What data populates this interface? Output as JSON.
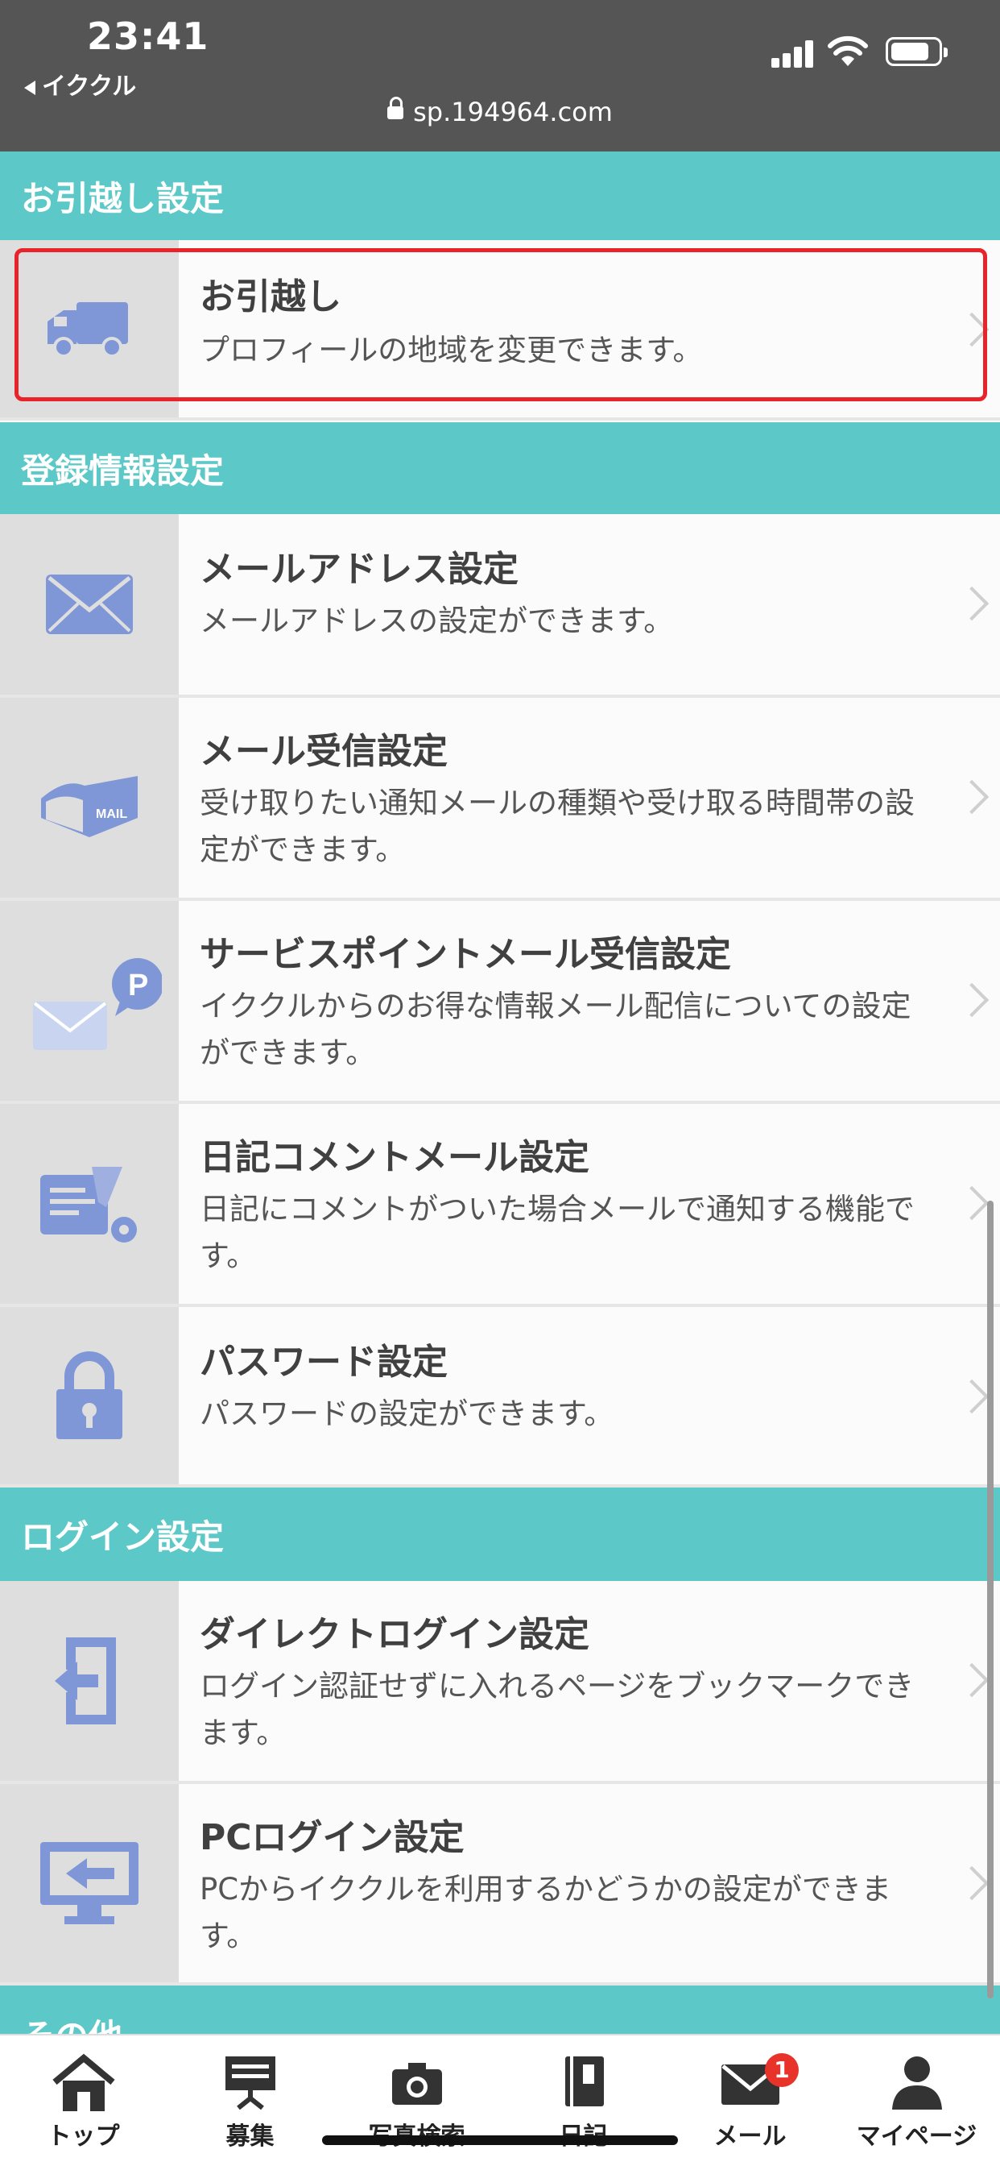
{
  "status": {
    "time": "23:41",
    "back_app": "イククル",
    "url": "sp.194964.com"
  },
  "sections": {
    "moving": {
      "header": "お引越し設定",
      "items": [
        {
          "title": "お引越し",
          "desc": "プロフィールの地域を変更できます。"
        }
      ]
    },
    "registration": {
      "header": "登録情報設定",
      "items": [
        {
          "title": "メールアドレス設定",
          "desc": "メールアドレスの設定ができます。"
        },
        {
          "title": "メール受信設定",
          "desc": "受け取りたい通知メールの種類や受け取る時間帯の設定ができます。"
        },
        {
          "title": "サービスポイントメール受信設定",
          "desc": "イククルからのお得な情報メール配信についての設定ができます。"
        },
        {
          "title": "日記コメントメール設定",
          "desc": "日記にコメントがついた場合メールで通知する機能です。"
        },
        {
          "title": "パスワード設定",
          "desc": "パスワードの設定ができます。"
        }
      ]
    },
    "login": {
      "header": "ログイン設定",
      "items": [
        {
          "title": "ダイレクトログイン設定",
          "desc": "ログイン認証せずに入れるページをブックマークできます。"
        },
        {
          "title": "PCログイン設定",
          "desc": "PCからイククルを利用するかどうかの設定ができます。"
        }
      ]
    },
    "other": {
      "header": "その他"
    }
  },
  "icons": {
    "moving": "truck-icon",
    "email": "envelope-icon",
    "mail_receive": "mailbox-icon",
    "service_point": "point-mail-icon",
    "diary": "diary-gear-icon",
    "password": "padlock-icon",
    "direct_login": "login-arrow-icon",
    "pc_login": "monitor-login-icon"
  },
  "nav": [
    {
      "label": "トップ",
      "icon": "home-icon"
    },
    {
      "label": "募集",
      "icon": "board-icon"
    },
    {
      "label": "写真検索",
      "icon": "camera-icon"
    },
    {
      "label": "日記",
      "icon": "notebook-icon"
    },
    {
      "label": "メール",
      "icon": "mail-icon",
      "badge": "1"
    },
    {
      "label": "マイページ",
      "icon": "person-icon"
    }
  ],
  "colors": {
    "header": "#5cc8c8",
    "icon": "#7f97d6",
    "highlight": "#e8232a",
    "badge": "#e8332a"
  }
}
